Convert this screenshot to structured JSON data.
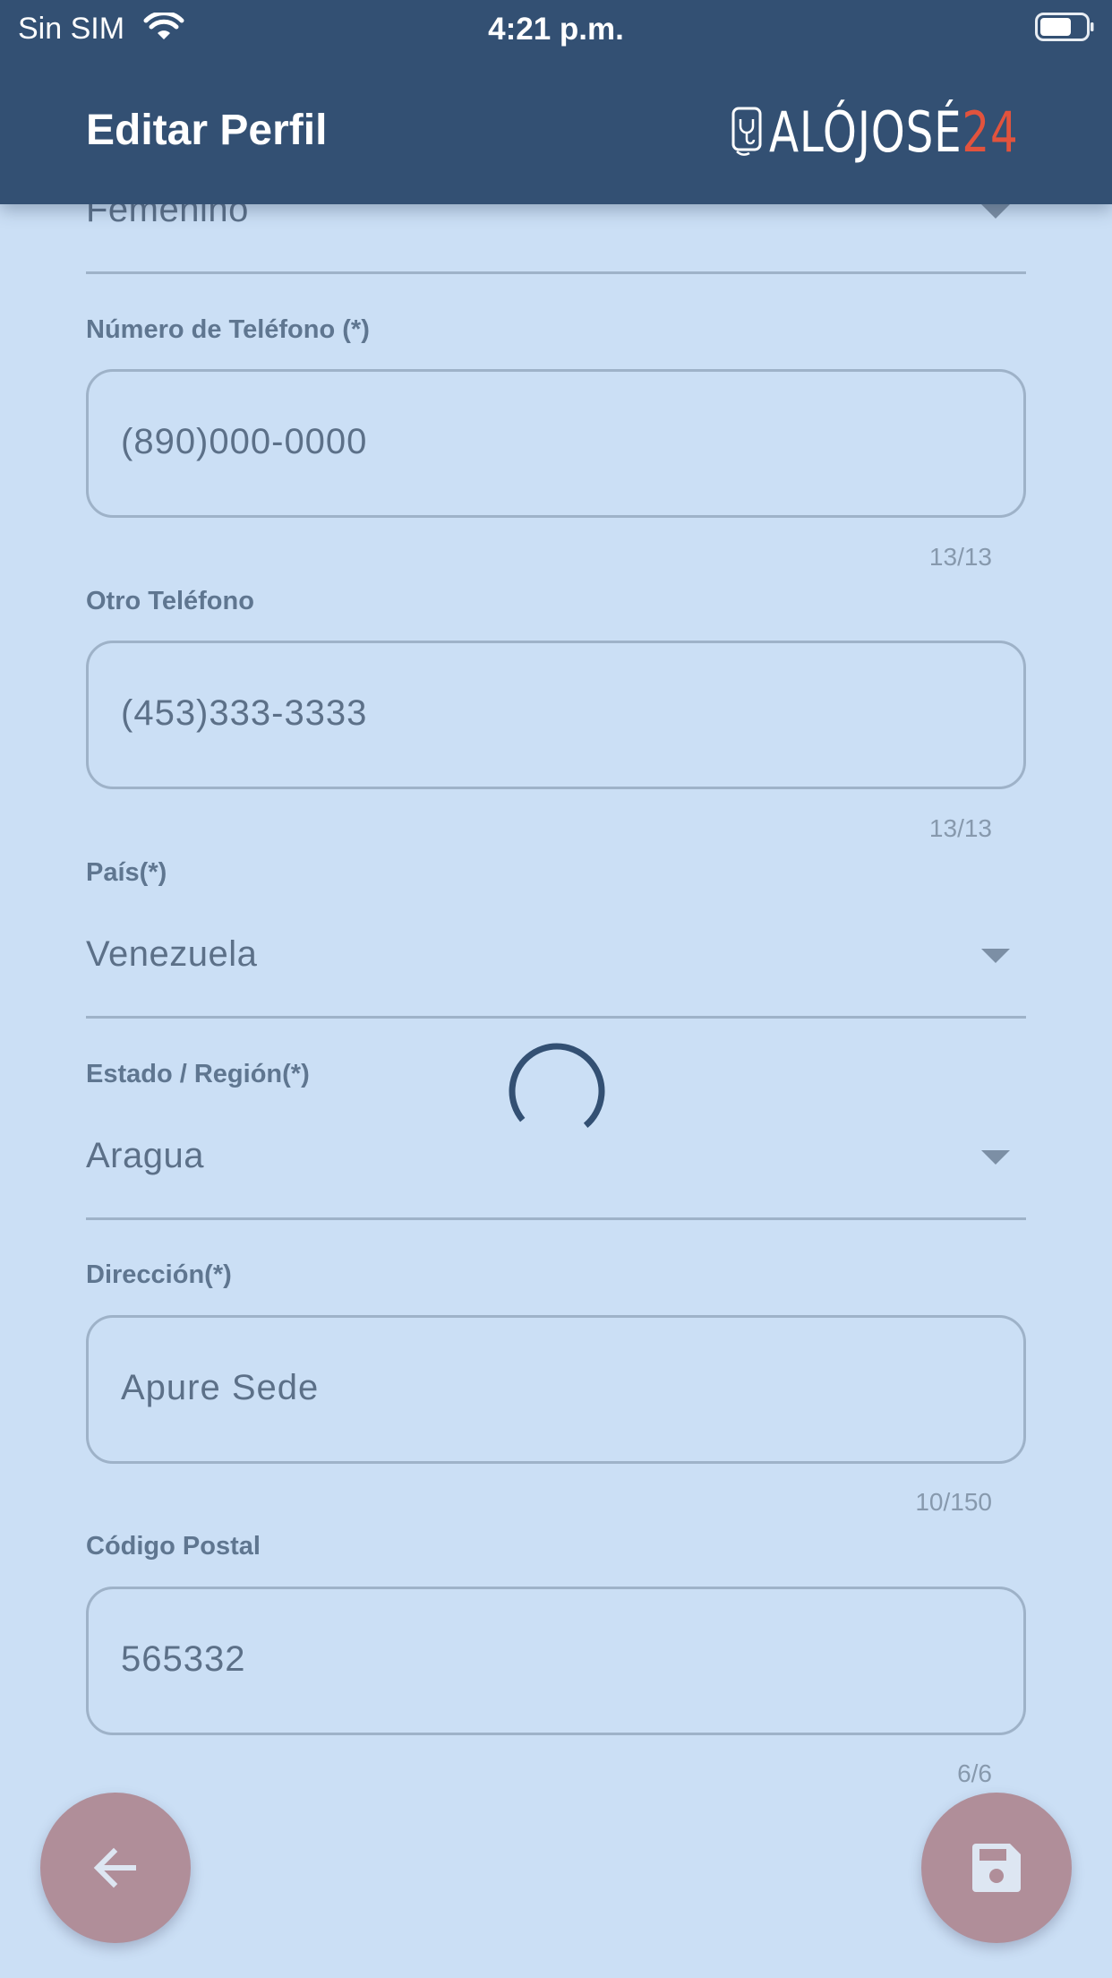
{
  "status_bar": {
    "carrier": "Sin SIM",
    "time": "4:21 p.m."
  },
  "header": {
    "title": "Editar Perfil",
    "logo_text": "ALÓJOSÉ",
    "logo_accent": "24"
  },
  "form": {
    "gender": {
      "value": "Femenino"
    },
    "phone": {
      "label": "Número de Teléfono (*)",
      "value": "(890)000-0000",
      "counter": "13/13"
    },
    "other_phone": {
      "label": "Otro Teléfono",
      "value": "(453)333-3333",
      "counter": "13/13"
    },
    "country": {
      "label": "País(*)",
      "value": "Venezuela"
    },
    "state": {
      "label": "Estado / Región(*)",
      "value": "Aragua"
    },
    "address": {
      "label": "Dirección(*)",
      "value": "Apure Sede",
      "counter": "10/150"
    },
    "postal": {
      "label": "Código Postal",
      "value": "565332",
      "counter": "6/6"
    }
  },
  "icons": {
    "back": "arrow-left-icon",
    "save": "floppy-disk-icon",
    "loading": "spinner-icon"
  },
  "colors": {
    "header_bg": "#335073",
    "page_bg": "#cbdff5",
    "fab_bg": "#b08e99",
    "logo_accent": "#e2533d"
  }
}
